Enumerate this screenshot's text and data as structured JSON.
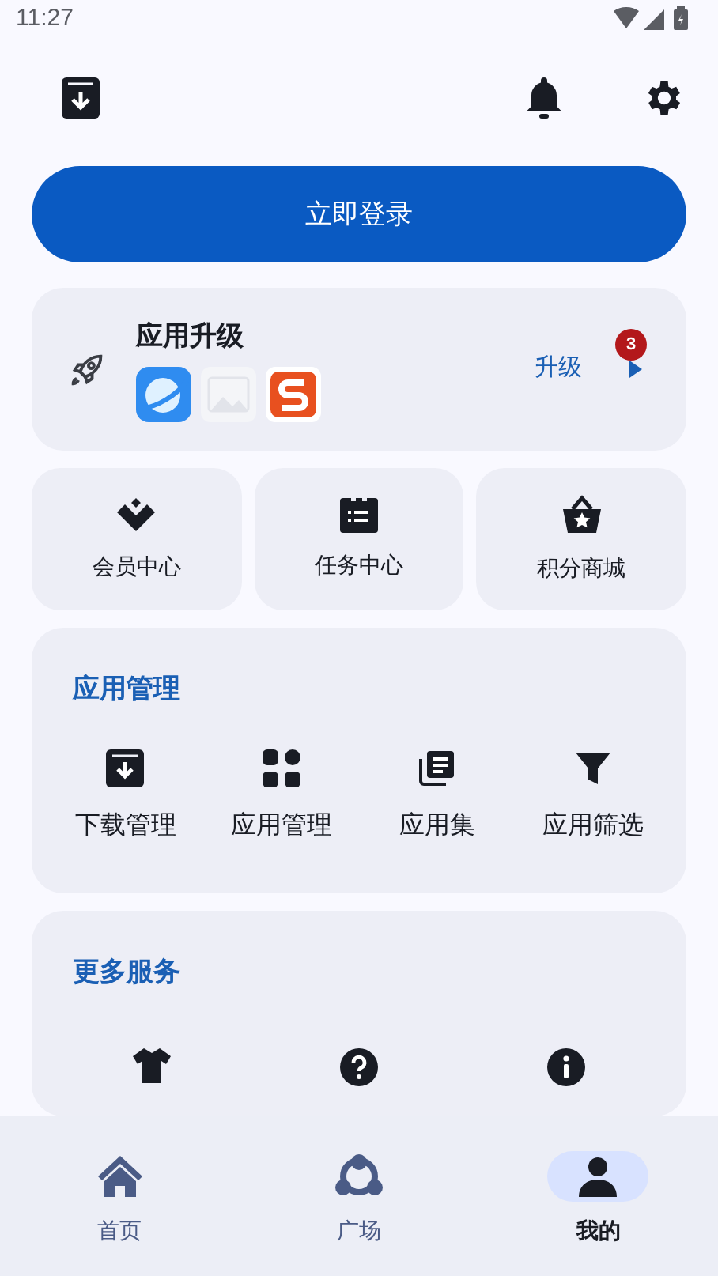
{
  "status_bar": {
    "time": "11:27"
  },
  "login_button": "立即登录",
  "upgrade_card": {
    "title": "应用升级",
    "action": "升级",
    "badge": "3"
  },
  "quick_tiles": [
    {
      "label": "会员中心"
    },
    {
      "label": "任务中心"
    },
    {
      "label": "积分商城"
    }
  ],
  "app_management": {
    "title": "应用管理",
    "items": [
      {
        "label": "下载管理"
      },
      {
        "label": "应用管理"
      },
      {
        "label": "应用集"
      },
      {
        "label": "应用筛选"
      }
    ]
  },
  "more_services": {
    "title": "更多服务"
  },
  "bottom_nav": [
    {
      "label": "首页",
      "selected": false
    },
    {
      "label": "广场",
      "selected": false
    },
    {
      "label": "我的",
      "selected": true
    }
  ]
}
